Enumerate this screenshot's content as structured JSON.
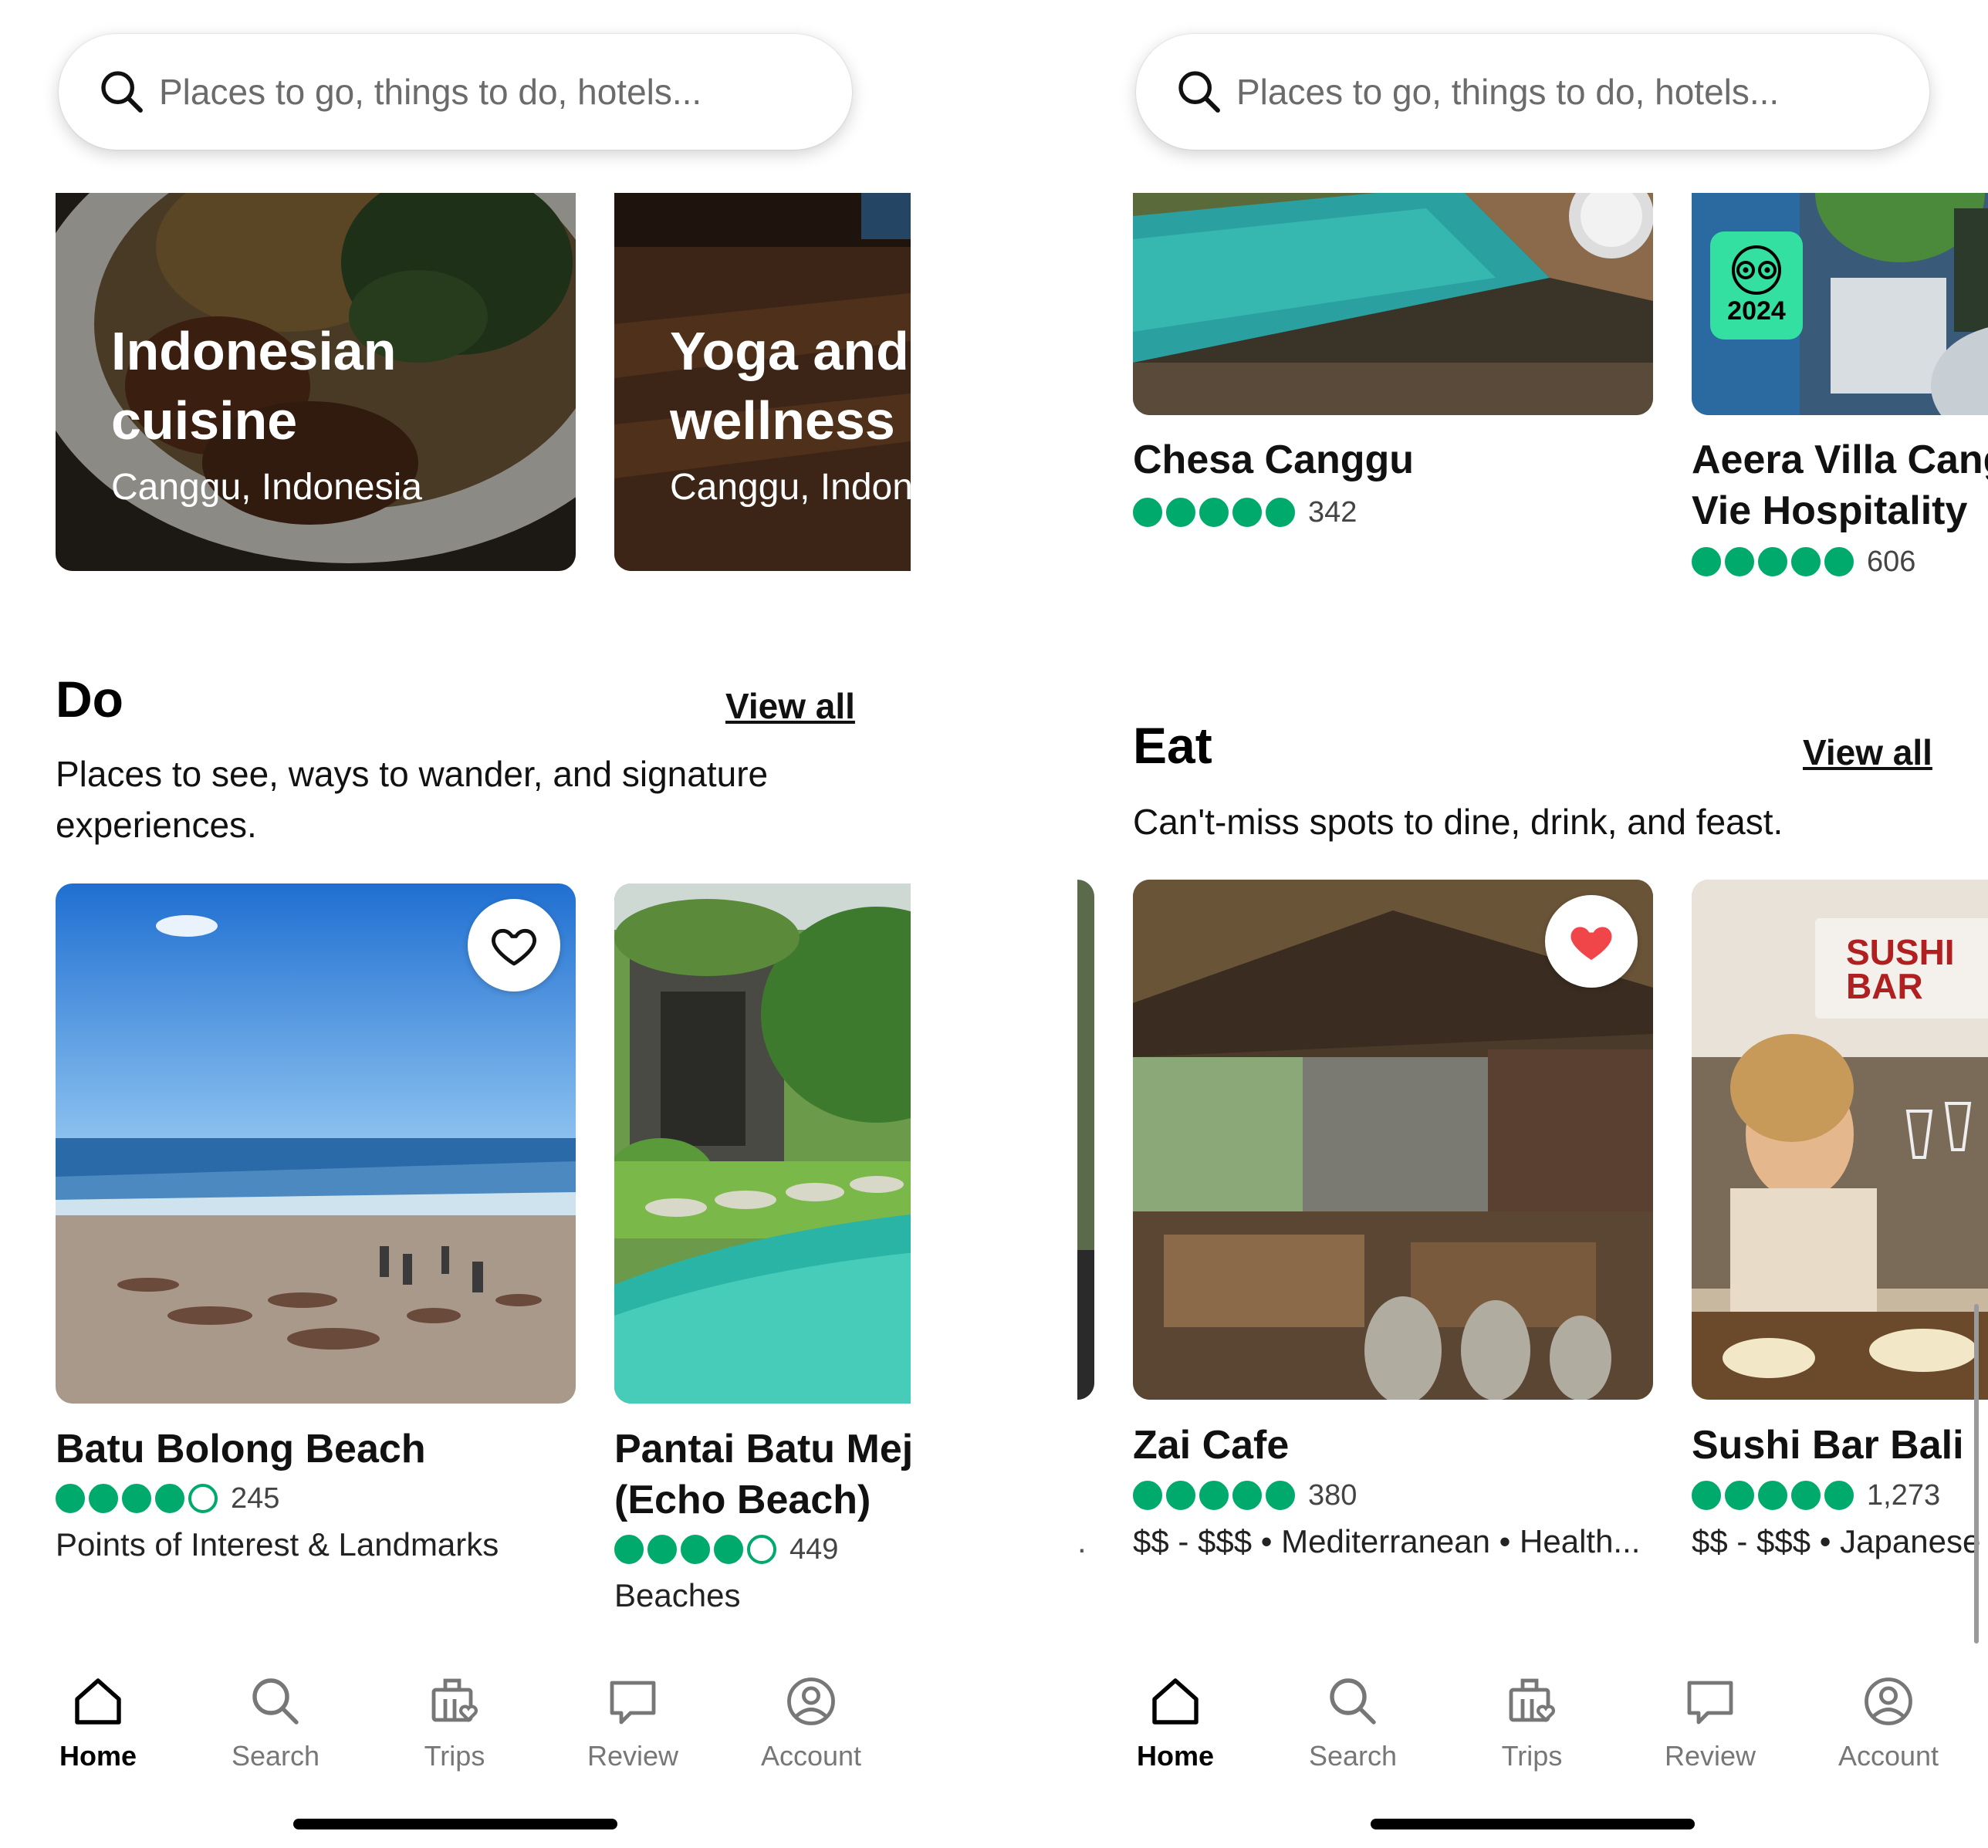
{
  "search": {
    "placeholder": "Places to go, things to do, hotels..."
  },
  "left": {
    "featured_cards": [
      {
        "title_line1": "Indonesian",
        "title_line2": "cuisine",
        "subtitle": "Canggu, Indonesia"
      },
      {
        "title_line1": "Yoga and",
        "title_line2": "wellness",
        "subtitle": "Canggu, Indonesia"
      }
    ],
    "section": {
      "title": "Do",
      "view_all": "View all",
      "desc_line1": "Places to see, ways to wander, and signature",
      "desc_line2": "experiences."
    },
    "places": [
      {
        "name_line1": "Batu Bolong Beach",
        "name_line2": "",
        "rating": 4,
        "reviews": "245",
        "category": "Points of Interest & Landmarks",
        "favorited": false
      },
      {
        "name_line1": "Pantai Batu Mejan",
        "name_line2": "(Echo Beach)",
        "rating": 4,
        "reviews": "449",
        "category": "Beaches",
        "favorited": false
      }
    ]
  },
  "right": {
    "hotels": [
      {
        "name_line1": "Chesa Canggu",
        "name_line2": "",
        "rating": 5,
        "reviews": "342"
      },
      {
        "name_line1": "Aeera Villa Canggu by",
        "name_line2": "Vie Hospitality",
        "rating": 5,
        "reviews": "606",
        "badge": "2024"
      }
    ],
    "section": {
      "title": "Eat",
      "view_all": "View all",
      "desc_line1": "Can't-miss spots to dine, drink, and feast."
    },
    "restaurants": [
      {
        "name": "Zai Cafe",
        "rating": 5,
        "reviews": "380",
        "category": "$$ - $$$ • Mediterranean • Health...",
        "favorited": true
      },
      {
        "name": "Sushi Bar Bali",
        "rating": 5,
        "reviews": "1,273",
        "category": "$$ - $$$ • Japanese",
        "favorited": false,
        "sign": "SUSHI BAR"
      }
    ],
    "truncated_left_dot": "."
  },
  "tabs": [
    {
      "label": "Home",
      "icon": "home-icon",
      "active": true
    },
    {
      "label": "Search",
      "icon": "search-icon",
      "active": false
    },
    {
      "label": "Trips",
      "icon": "trips-icon",
      "active": false
    },
    {
      "label": "Review",
      "icon": "review-icon",
      "active": false
    },
    {
      "label": "Account",
      "icon": "account-icon",
      "active": false
    }
  ],
  "colors": {
    "rating_green": "#00aa6c",
    "badge_green": "#34e0a1",
    "heart_red": "#f0464a"
  }
}
